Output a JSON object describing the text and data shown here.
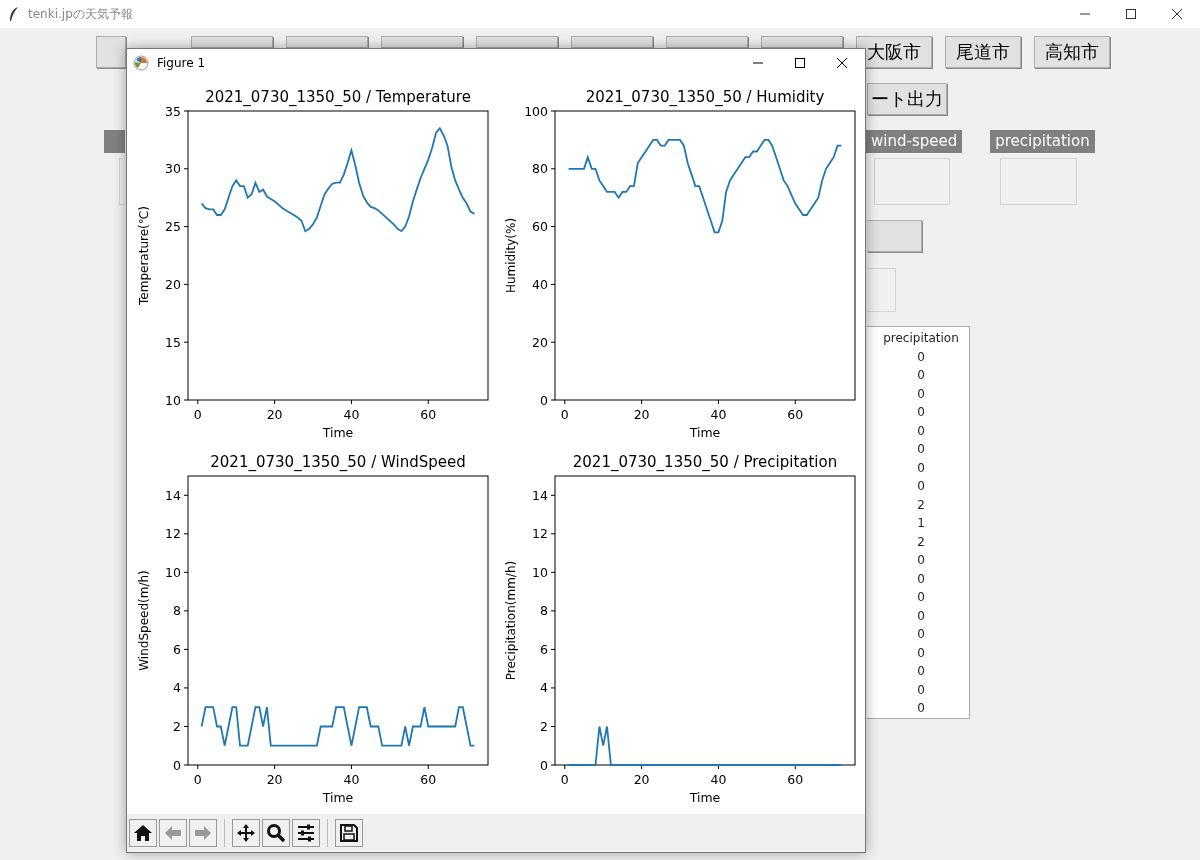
{
  "app_window": {
    "title": "tenki.jpの天気予報"
  },
  "city_buttons": [
    {
      "kind": "covered"
    },
    {
      "kind": "covered"
    },
    {
      "kind": "covered"
    },
    {
      "kind": "covered"
    },
    {
      "kind": "covered"
    },
    {
      "kind": "covered"
    },
    {
      "kind": "covered"
    },
    {
      "kind": "covered"
    },
    {
      "kind": "label",
      "label": "大阪市"
    },
    {
      "kind": "label",
      "label": "尾道市"
    },
    {
      "kind": "label",
      "label": "高知市"
    }
  ],
  "export_button": {
    "label": "ート出力"
  },
  "field_labels": [
    {
      "kind": "covered"
    },
    {
      "kind": "label",
      "text": "wind-speed"
    },
    {
      "kind": "label",
      "text": "precipitation"
    }
  ],
  "table": {
    "column": "precipitation",
    "rows": [
      "0",
      "0",
      "0",
      "0",
      "0",
      "0",
      "0",
      "0",
      "2",
      "1",
      "2",
      "0",
      "0",
      "0",
      "0",
      "0",
      "0",
      "0",
      "0",
      "0"
    ]
  },
  "figure_window": {
    "title": "Figure 1",
    "charts": [
      {
        "chart_data": {
          "type": "line",
          "title": "2021_0730_1350_50 / Temperature",
          "xlabel": "Time",
          "ylabel": "Temperature(℃)",
          "xlim": [
            -2.55,
            75.55
          ],
          "ylim": [
            10,
            35
          ],
          "xticks": [
            0,
            20,
            40,
            60
          ],
          "yticks": [
            10,
            15,
            20,
            25,
            30,
            35
          ],
          "x": [
            1,
            2,
            3,
            4,
            5,
            6,
            7,
            8,
            9,
            10,
            11,
            12,
            13,
            14,
            15,
            16,
            17,
            18,
            19,
            20,
            21,
            22,
            23,
            24,
            25,
            26,
            27,
            28,
            29,
            30,
            31,
            32,
            33,
            34,
            35,
            36,
            37,
            38,
            39,
            40,
            41,
            42,
            43,
            44,
            45,
            46,
            47,
            48,
            49,
            50,
            51,
            52,
            53,
            54,
            55,
            56,
            57,
            58,
            59,
            60,
            61,
            62,
            63,
            64,
            65,
            66,
            67,
            68,
            69,
            70,
            71,
            72
          ],
          "series": [
            {
              "color": "#1f77b4",
              "values": [
                27,
                26.6,
                26.5,
                26.5,
                26,
                26,
                26.5,
                27.5,
                28.5,
                29,
                28.5,
                28.5,
                27.5,
                27.8,
                28.8,
                28,
                28.2,
                27.6,
                27.4,
                27.2,
                26.9,
                26.6,
                26.4,
                26.2,
                26,
                25.8,
                25.5,
                24.6,
                24.8,
                25.2,
                25.8,
                26.8,
                27.8,
                28.3,
                28.7,
                28.8,
                28.8,
                29.5,
                30.5,
                31.6,
                30.3,
                28.8,
                27.7,
                27.1,
                26.7,
                26.6,
                26.4,
                26.1,
                25.8,
                25.5,
                25.2,
                24.8,
                24.6,
                25,
                25.9,
                27.2,
                28.2,
                29.2,
                30,
                30.8,
                31.8,
                33.1,
                33.5,
                32.9,
                32,
                30.2,
                29,
                28.2,
                27.5,
                27,
                26.3,
                26.1
              ]
            }
          ]
        }
      },
      {
        "chart_data": {
          "type": "line",
          "title": "2021_0730_1350_50 / Humidity",
          "xlabel": "Time",
          "ylabel": "Humidity(%)",
          "xlim": [
            -2.55,
            75.55
          ],
          "ylim": [
            0,
            100
          ],
          "xticks": [
            0,
            20,
            40,
            60
          ],
          "yticks": [
            0,
            20,
            40,
            60,
            80,
            100
          ],
          "x": [
            1,
            2,
            3,
            4,
            5,
            6,
            7,
            8,
            9,
            10,
            11,
            12,
            13,
            14,
            15,
            16,
            17,
            18,
            19,
            20,
            21,
            22,
            23,
            24,
            25,
            26,
            27,
            28,
            29,
            30,
            31,
            32,
            33,
            34,
            35,
            36,
            37,
            38,
            39,
            40,
            41,
            42,
            43,
            44,
            45,
            46,
            47,
            48,
            49,
            50,
            51,
            52,
            53,
            54,
            55,
            56,
            57,
            58,
            59,
            60,
            61,
            62,
            63,
            64,
            65,
            66,
            67,
            68,
            69,
            70,
            71,
            72
          ],
          "series": [
            {
              "color": "#1f77b4",
              "values": [
                80,
                80,
                80,
                80,
                80,
                84,
                80,
                80,
                76,
                74,
                72,
                72,
                72,
                70,
                72,
                72,
                74,
                74,
                82,
                84,
                86,
                88,
                90,
                90,
                88,
                88,
                90,
                90,
                90,
                90,
                88,
                82,
                78,
                74,
                74,
                70,
                66,
                62,
                58,
                58,
                62,
                72,
                76,
                78,
                80,
                82,
                84,
                84,
                86,
                86,
                88,
                90,
                90,
                88,
                84,
                80,
                76,
                74,
                71,
                68,
                66,
                64,
                64,
                66,
                68,
                70,
                76,
                80,
                82,
                84,
                88,
                88
              ]
            }
          ]
        }
      },
      {
        "chart_data": {
          "type": "line",
          "title": "2021_0730_1350_50 / WindSpeed",
          "xlabel": "Time",
          "ylabel": "WindSpeed(m/h)",
          "xlim": [
            -2.55,
            75.55
          ],
          "ylim": [
            0,
            15
          ],
          "xticks": [
            0,
            20,
            40,
            60
          ],
          "yticks": [
            0,
            2,
            4,
            6,
            8,
            10,
            12,
            14
          ],
          "x": [
            1,
            2,
            3,
            4,
            5,
            6,
            7,
            8,
            9,
            10,
            11,
            12,
            13,
            14,
            15,
            16,
            17,
            18,
            19,
            20,
            21,
            22,
            23,
            24,
            25,
            26,
            27,
            28,
            29,
            30,
            31,
            32,
            33,
            34,
            35,
            36,
            37,
            38,
            39,
            40,
            41,
            42,
            43,
            44,
            45,
            46,
            47,
            48,
            49,
            50,
            51,
            52,
            53,
            54,
            55,
            56,
            57,
            58,
            59,
            60,
            61,
            62,
            63,
            64,
            65,
            66,
            67,
            68,
            69,
            70,
            71,
            72
          ],
          "series": [
            {
              "color": "#1f77b4",
              "values": [
                2,
                3,
                3,
                3,
                2,
                2,
                1,
                2,
                3,
                3,
                1,
                1,
                1,
                2,
                3,
                3,
                2,
                3,
                1,
                1,
                1,
                1,
                1,
                1,
                1,
                1,
                1,
                1,
                1,
                1,
                1,
                2,
                2,
                2,
                2,
                3,
                3,
                3,
                2,
                1,
                2,
                3,
                3,
                3,
                2,
                2,
                2,
                1,
                1,
                1,
                1,
                1,
                1,
                2,
                1,
                2,
                2,
                2,
                3,
                2,
                2,
                2,
                2,
                2,
                2,
                2,
                2,
                3,
                3,
                2,
                1,
                1
              ]
            }
          ]
        }
      },
      {
        "chart_data": {
          "type": "line",
          "title": "2021_0730_1350_50 / Precipitation",
          "xlabel": "Time",
          "ylabel": "Precipitation(mm/h)",
          "xlim": [
            -2.55,
            75.55
          ],
          "ylim": [
            0,
            15
          ],
          "xticks": [
            0,
            20,
            40,
            60
          ],
          "yticks": [
            0,
            2,
            4,
            6,
            8,
            10,
            12,
            14
          ],
          "x": [
            1,
            2,
            3,
            4,
            5,
            6,
            7,
            8,
            9,
            10,
            11,
            12,
            13,
            14,
            15,
            16,
            17,
            18,
            19,
            20,
            21,
            22,
            23,
            24,
            25,
            26,
            27,
            28,
            29,
            30,
            31,
            32,
            33,
            34,
            35,
            36,
            37,
            38,
            39,
            40,
            41,
            42,
            43,
            44,
            45,
            46,
            47,
            48,
            49,
            50,
            51,
            52,
            53,
            54,
            55,
            56,
            57,
            58,
            59,
            60,
            61,
            62,
            63,
            64,
            65,
            66,
            67,
            68,
            69,
            70,
            71,
            72
          ],
          "series": [
            {
              "color": "#1f77b4",
              "values": [
                0,
                0,
                0,
                0,
                0,
                0,
                0,
                0,
                2,
                1,
                2,
                0,
                0,
                0,
                0,
                0,
                0,
                0,
                0,
                0,
                0,
                0,
                0,
                0,
                0,
                0,
                0,
                0,
                0,
                0,
                0,
                0,
                0,
                0,
                0,
                0,
                0,
                0,
                0,
                0,
                0,
                0,
                0,
                0,
                0,
                0,
                0,
                0,
                0,
                0,
                0,
                0,
                0,
                0,
                0,
                0,
                0,
                0,
                0,
                0,
                0,
                0,
                0,
                0,
                0,
                0,
                0,
                0,
                0,
                0,
                0,
                0
              ]
            }
          ]
        }
      }
    ],
    "toolbar": [
      {
        "kind": "home",
        "disabled": false
      },
      {
        "kind": "back",
        "disabled": true
      },
      {
        "kind": "forward",
        "disabled": true
      },
      {
        "kind": "pan",
        "disabled": false
      },
      {
        "kind": "zoom",
        "disabled": false
      },
      {
        "kind": "configure",
        "disabled": false
      },
      {
        "kind": "save",
        "disabled": false
      }
    ]
  }
}
